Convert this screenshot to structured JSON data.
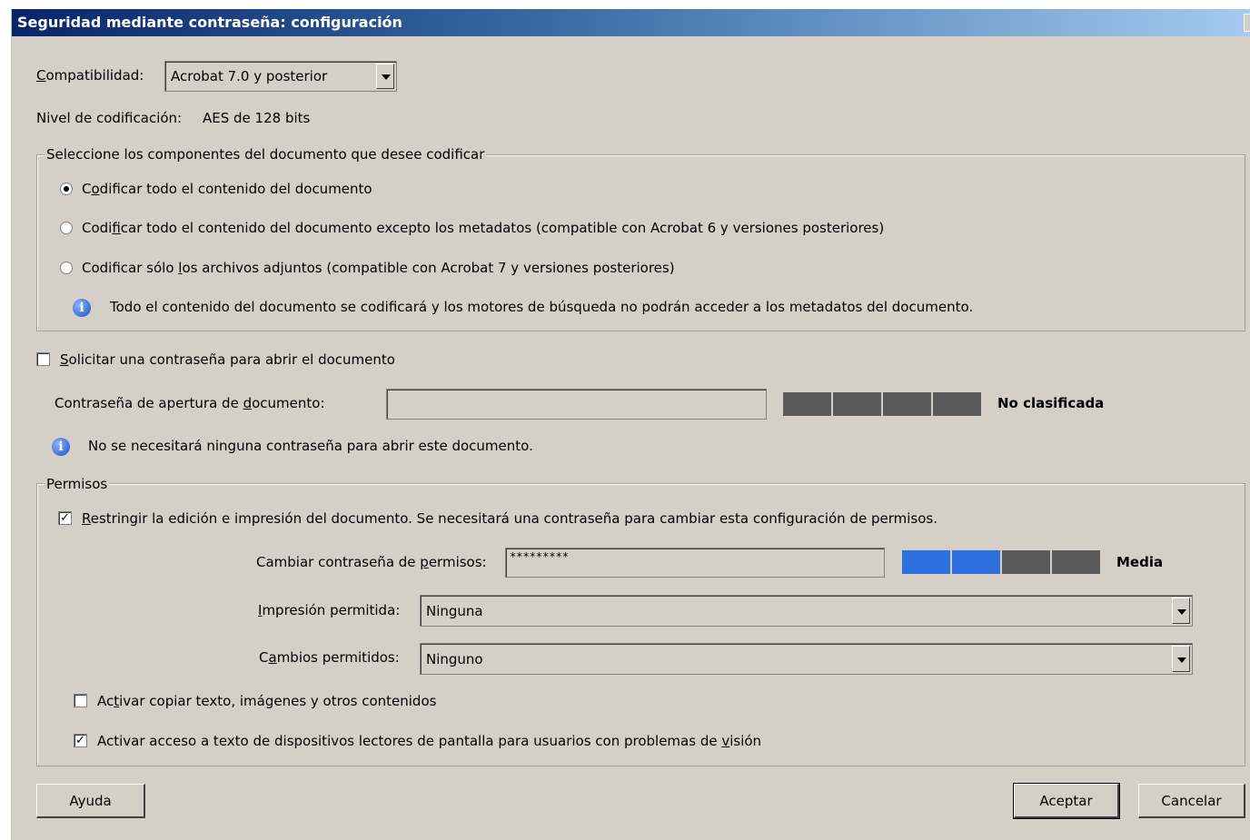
{
  "window": {
    "title": "Seguridad mediante contraseña: configuración"
  },
  "compatibility": {
    "label_key": "C",
    "label_rest": "ompatibilidad:",
    "value": "Acrobat 7.0 y posterior"
  },
  "encryption_level": {
    "label": "Nivel de codificación:",
    "value": "AES de 128 bits"
  },
  "components": {
    "legend": "Seleccione los componentes del documento que desee codificar",
    "options": [
      {
        "pre": "C",
        "key": "o",
        "post": "dificar todo el contenido del documento",
        "selected": true
      },
      {
        "pre": "Codi",
        "key": "f",
        "post": "icar todo el contenido del documento excepto los metadatos (compatible con Acrobat 6 y versiones posteriores)",
        "selected": false
      },
      {
        "pre": "Codificar sólo ",
        "key": "l",
        "post": "os archivos adjuntos (compatible con Acrobat 7 y versiones posteriores)",
        "selected": false
      }
    ],
    "info": "Todo el contenido del documento se codificará y los motores de búsqueda no podrán acceder a los metadatos del documento."
  },
  "open_password": {
    "checkbox_key": "S",
    "checkbox_rest": "olicitar una contraseña para abrir el documento",
    "checked": false,
    "field_pre": "Contraseña de apertura de ",
    "field_key": "d",
    "field_post": "ocumento:",
    "value": "",
    "strength_label": "No clasificada",
    "strength_level": 0,
    "info": "No se necesitará ninguna contraseña para abrir este documento."
  },
  "permissions": {
    "legend": "Permisos",
    "restrict_key": "R",
    "restrict_rest": "estringir la edición e impresión del documento. Se necesitará una contraseña para cambiar esta configuración de permisos.",
    "restrict_checked": true,
    "change_pw_pre": "Cambiar contraseña de ",
    "change_pw_key": "p",
    "change_pw_post": "ermisos:",
    "change_pw_value": "*********",
    "strength_label": "Media",
    "strength_level": 2,
    "print_key": "I",
    "print_rest": "mpresión permitida:",
    "print_value": "Ninguna",
    "changes_pre": "C",
    "changes_key": "a",
    "changes_post": "mbios permitidos:",
    "changes_value": "Ninguno",
    "copy_pre": "Ac",
    "copy_key": "t",
    "copy_post": "ivar copiar texto, imágenes y otros contenidos",
    "copy_checked": false,
    "reader_pre": "Activar acceso a texto de dispositivos lectores de pantalla para usuarios con problemas de ",
    "reader_key": "v",
    "reader_post": "isión",
    "reader_checked": true
  },
  "buttons": {
    "help": "Ayuda",
    "ok": "Aceptar",
    "cancel": "Cancelar"
  },
  "colors": {
    "strength_active": "#2e6fe0",
    "strength_inactive": "#5a5a5a"
  }
}
